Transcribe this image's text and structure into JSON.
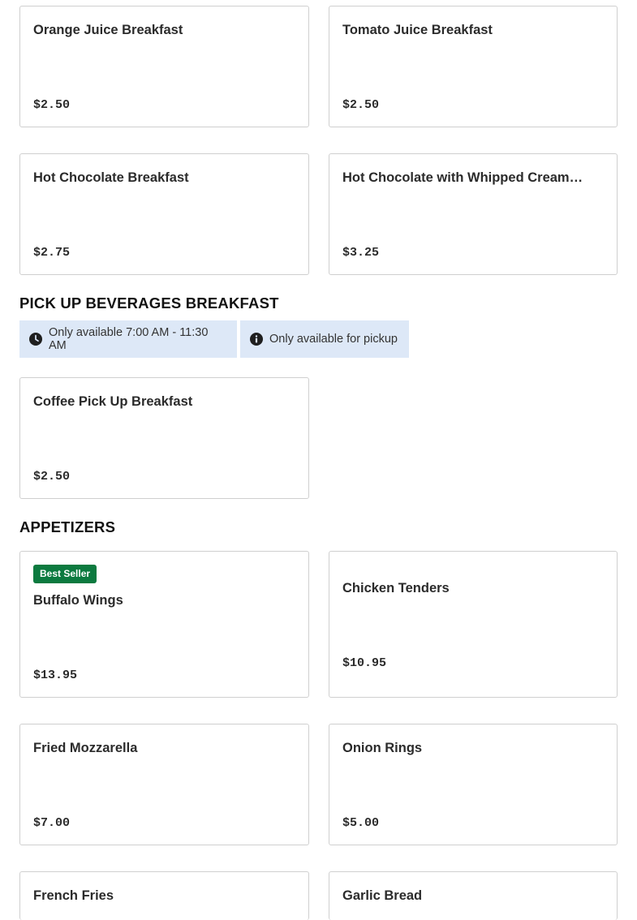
{
  "sections": [
    {
      "heading": ""
    },
    {
      "heading": "PICK UP BEVERAGES BREAKFAST",
      "chips": [
        {
          "icon": "clock-icon",
          "text": "Only available 7:00 AM - 11:30 AM"
        },
        {
          "icon": "info-icon",
          "text": "Only available for pickup"
        }
      ]
    },
    {
      "heading": "APPETIZERS"
    }
  ],
  "items": [
    {
      "name": "Orange Juice Breakfast",
      "price": "$2.50",
      "badge": ""
    },
    {
      "name": "Tomato Juice Breakfast",
      "price": "$2.50",
      "badge": ""
    },
    {
      "name": "Hot Chocolate Breakfast",
      "price": "$2.75",
      "badge": ""
    },
    {
      "name": "Hot Chocolate with Whipped Cream…",
      "price": "$3.25",
      "badge": ""
    },
    {
      "name": "Coffee Pick Up Breakfast",
      "price": "$2.50",
      "badge": ""
    },
    {
      "name": "Buffalo Wings",
      "price": "$13.95",
      "badge": "Best Seller"
    },
    {
      "name": "Chicken Tenders",
      "price": "$10.95",
      "badge": ""
    },
    {
      "name": "Fried Mozzarella",
      "price": "$7.00",
      "badge": ""
    },
    {
      "name": "Onion Rings",
      "price": "$5.00",
      "badge": ""
    },
    {
      "name": "French Fries",
      "price": "",
      "badge": ""
    },
    {
      "name": "Garlic Bread",
      "price": "",
      "badge": ""
    }
  ],
  "colors": {
    "chip_bg": "#dde8f7",
    "badge_bg": "#0c7a3f",
    "card_border": "#cfcfcf"
  }
}
